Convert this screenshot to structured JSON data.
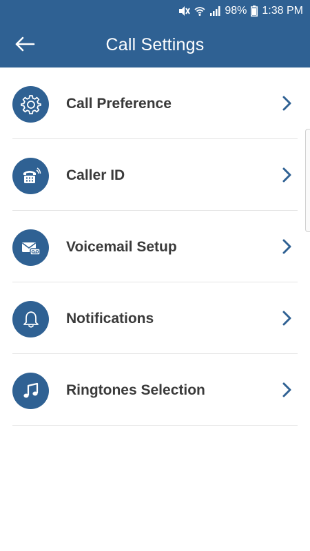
{
  "colors": {
    "primary": "#2f6193",
    "label_text": "#3a3a3a",
    "divider": "#e4e4e4",
    "background": "#ffffff"
  },
  "status_bar": {
    "battery": "98%",
    "time": "1:38 PM",
    "icons": [
      "mute-vibrate-icon",
      "wifi-icon",
      "signal-icon",
      "battery-icon"
    ]
  },
  "app_bar": {
    "title": "Call Settings",
    "back_icon": "back-arrow-icon"
  },
  "settings": {
    "items": [
      {
        "label": "Call Preference",
        "icon": "gear-icon"
      },
      {
        "label": "Caller ID",
        "icon": "phone-icon"
      },
      {
        "label": "Voicemail Setup",
        "icon": "voicemail-icon"
      },
      {
        "label": "Notifications",
        "icon": "bell-icon"
      },
      {
        "label": "Ringtones Selection",
        "icon": "music-note-icon"
      }
    ]
  }
}
